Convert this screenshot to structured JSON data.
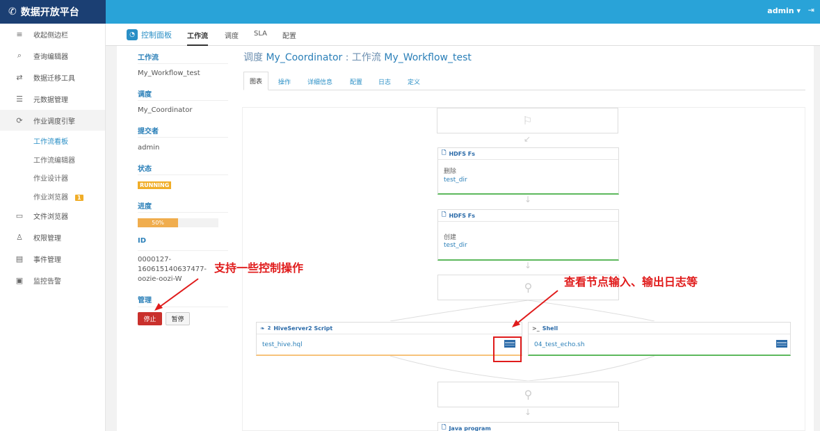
{
  "app": {
    "brand": "数据开放平台",
    "user": "admin ▾",
    "logout_icon": "logout-icon"
  },
  "sidebar": {
    "items": [
      {
        "label": "收起侧边栏",
        "icon": "menu-icon"
      },
      {
        "label": "查询编辑器",
        "icon": "query-icon"
      },
      {
        "label": "数据迁移工具",
        "icon": "transfer-icon"
      },
      {
        "label": "元数据管理",
        "icon": "database-icon"
      },
      {
        "label": "作业调度引擎",
        "icon": "scheduler-icon"
      },
      {
        "label": "文件浏览器",
        "icon": "folder-icon"
      },
      {
        "label": "权限管理",
        "icon": "user-lock-icon"
      },
      {
        "label": "事件管理",
        "icon": "event-icon"
      },
      {
        "label": "监控告警",
        "icon": "monitor-icon"
      }
    ],
    "subitems": [
      {
        "label": "工作流看板"
      },
      {
        "label": "工作流编辑器"
      },
      {
        "label": "作业设计器"
      },
      {
        "label": "作业浏览器",
        "badge": "1"
      }
    ]
  },
  "subnav": {
    "dashboard": "控制面板",
    "workflow": "工作流",
    "schedule": "调度",
    "sla": "SLA",
    "config": "配置"
  },
  "info": {
    "workflow_h": "工作流",
    "workflow_v": "My_Workflow_test",
    "coord_h": "调度",
    "coord_v": "My_Coordinator",
    "submitter_h": "提交者",
    "submitter_v": "admin",
    "status_h": "状态",
    "status_v": "RUNNING",
    "progress_h": "进度",
    "progress_v": "50%",
    "progress_fraction": 0.5,
    "id_h": "ID",
    "id_l1": "0000127-",
    "id_l2": "160615140637477-",
    "id_l3": "oozie-oozi-W",
    "manage_h": "管理",
    "stop": "停止",
    "pause": "暂停"
  },
  "title": {
    "prefix": "调度",
    "coord": "My_Coordinator",
    "sep": ": 工作流",
    "wf": "My_Workflow_test"
  },
  "tabs": [
    "图表",
    "操作",
    "详细信息",
    "配置",
    "日志",
    "定义"
  ],
  "nodes": {
    "hdfs1": {
      "title": "HDFS Fs",
      "l1": "删除",
      "l2": "test_dir"
    },
    "hdfs2": {
      "title": "HDFS Fs",
      "l1": "创建",
      "l2": "test_dir"
    },
    "hive": {
      "title": "HiveServer2 Script",
      "sup": "2",
      "l2": "test_hive.hql"
    },
    "shell": {
      "title": "Shell",
      "prefix": ">_",
      "l2": "04_test_echo.sh"
    },
    "java": {
      "title": "Java program"
    }
  },
  "annotations": {
    "left": "支持一些控制操作",
    "right": "查看节点输入、输出日志等"
  },
  "colors": {
    "accent": "#29a3d8",
    "running": "#f0ad28",
    "stop": "#c9302c",
    "annotation": "#e01b1b"
  }
}
